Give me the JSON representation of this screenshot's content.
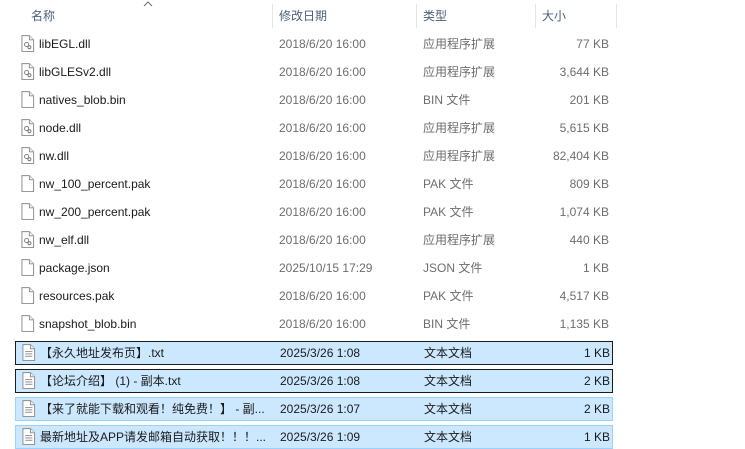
{
  "header": {
    "name": "名称",
    "date": "修改日期",
    "type": "类型",
    "size": "大小"
  },
  "files": [
    {
      "name": "libEGL.dll",
      "date": "2018/6/20 16:00",
      "type": "应用程序扩展",
      "size": "77 KB",
      "icon": "dll-file-icon"
    },
    {
      "name": "libGLESv2.dll",
      "date": "2018/6/20 16:00",
      "type": "应用程序扩展",
      "size": "3,644 KB",
      "icon": "dll-file-icon"
    },
    {
      "name": "natives_blob.bin",
      "date": "2018/6/20 16:00",
      "type": "BIN 文件",
      "size": "201 KB",
      "icon": "file-icon"
    },
    {
      "name": "node.dll",
      "date": "2018/6/20 16:00",
      "type": "应用程序扩展",
      "size": "5,615 KB",
      "icon": "dll-file-icon"
    },
    {
      "name": "nw.dll",
      "date": "2018/6/20 16:00",
      "type": "应用程序扩展",
      "size": "82,404 KB",
      "icon": "dll-file-icon"
    },
    {
      "name": "nw_100_percent.pak",
      "date": "2018/6/20 16:00",
      "type": "PAK 文件",
      "size": "809 KB",
      "icon": "file-icon"
    },
    {
      "name": "nw_200_percent.pak",
      "date": "2018/6/20 16:00",
      "type": "PAK 文件",
      "size": "1,074 KB",
      "icon": "file-icon"
    },
    {
      "name": "nw_elf.dll",
      "date": "2018/6/20 16:00",
      "type": "应用程序扩展",
      "size": "440 KB",
      "icon": "dll-file-icon"
    },
    {
      "name": "package.json",
      "date": "2025/10/15 17:29",
      "type": "JSON 文件",
      "size": "1 KB",
      "icon": "file-icon"
    },
    {
      "name": "resources.pak",
      "date": "2018/6/20 16:00",
      "type": "PAK 文件",
      "size": "4,517 KB",
      "icon": "file-icon"
    },
    {
      "name": "snapshot_blob.bin",
      "date": "2018/6/20 16:00",
      "type": "BIN 文件",
      "size": "1,135 KB",
      "icon": "file-icon"
    },
    {
      "name": "【永久地址发布页】.txt",
      "date": "2025/3/26 1:08",
      "type": "文本文档",
      "size": "1 KB",
      "icon": "text-file-icon",
      "selected": true,
      "focused": true
    },
    {
      "name": "【论坛介绍】 (1) - 副本.txt",
      "date": "2025/3/26 1:08",
      "type": "文本文档",
      "size": "2 KB",
      "icon": "text-file-icon",
      "selected": true,
      "focused": true
    },
    {
      "name": "【来了就能下载和观看！纯免费！】 - 副...",
      "date": "2025/3/26 1:07",
      "type": "文本文档",
      "size": "2 KB",
      "icon": "text-file-icon",
      "selected": true
    },
    {
      "name": "最新地址及APP请发邮箱自动获取！！！...",
      "date": "2025/3/26 1:09",
      "type": "文本文档",
      "size": "1 KB",
      "icon": "text-file-icon",
      "selected": true
    }
  ]
}
